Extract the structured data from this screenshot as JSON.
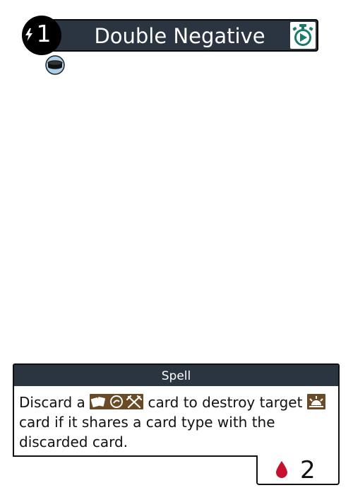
{
  "card": {
    "title": "Double Negative",
    "energy_cost": "1",
    "type_line": "Spell",
    "rules": {
      "part1": "Discard a",
      "part2": "card to destroy target",
      "part3": "card if it shares a card type with the discarded card."
    },
    "secondary_cost": "2",
    "icons": {
      "energy": "lightning-bolt-icon",
      "speed": "stopwatch-play-icon",
      "token": "disc-token-icon",
      "types_discard": [
        "cards-icon",
        "hand-icon",
        "crossed-tools-icon"
      ],
      "type_target": "sunrise-icon",
      "secondary": "blood-drop-icon"
    },
    "colors": {
      "bar": "#2b3542",
      "speed_icon": "#1a7a6e",
      "type_chip": "#6b4a26",
      "blood": "#c8102e",
      "token": "#a9cfea"
    }
  }
}
